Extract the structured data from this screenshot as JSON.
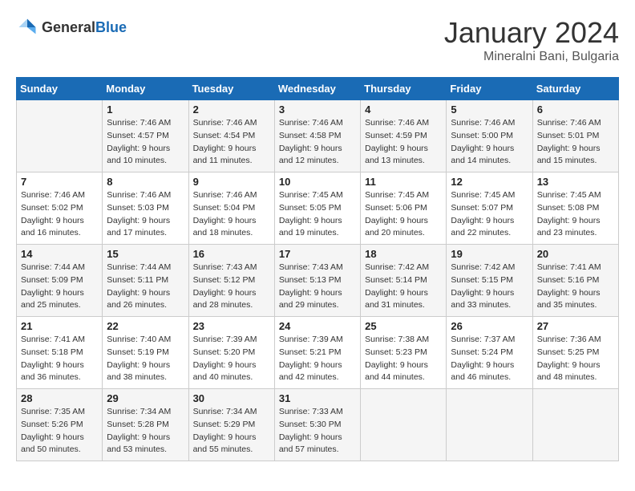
{
  "logo": {
    "text_general": "General",
    "text_blue": "Blue"
  },
  "calendar": {
    "title": "January 2024",
    "subtitle": "Mineralni Bani, Bulgaria"
  },
  "days_of_week": [
    "Sunday",
    "Monday",
    "Tuesday",
    "Wednesday",
    "Thursday",
    "Friday",
    "Saturday"
  ],
  "weeks": [
    [
      {
        "day": "",
        "sunrise": "",
        "sunset": "",
        "daylight": ""
      },
      {
        "day": "1",
        "sunrise": "Sunrise: 7:46 AM",
        "sunset": "Sunset: 4:57 PM",
        "daylight": "Daylight: 9 hours and 10 minutes."
      },
      {
        "day": "2",
        "sunrise": "Sunrise: 7:46 AM",
        "sunset": "Sunset: 4:54 PM",
        "daylight": "Daylight: 9 hours and 11 minutes."
      },
      {
        "day": "3",
        "sunrise": "Sunrise: 7:46 AM",
        "sunset": "Sunset: 4:58 PM",
        "daylight": "Daylight: 9 hours and 12 minutes."
      },
      {
        "day": "4",
        "sunrise": "Sunrise: 7:46 AM",
        "sunset": "Sunset: 4:59 PM",
        "daylight": "Daylight: 9 hours and 13 minutes."
      },
      {
        "day": "5",
        "sunrise": "Sunrise: 7:46 AM",
        "sunset": "Sunset: 5:00 PM",
        "daylight": "Daylight: 9 hours and 14 minutes."
      },
      {
        "day": "6",
        "sunrise": "Sunrise: 7:46 AM",
        "sunset": "Sunset: 5:01 PM",
        "daylight": "Daylight: 9 hours and 15 minutes."
      }
    ],
    [
      {
        "day": "7",
        "sunrise": "Sunrise: 7:46 AM",
        "sunset": "Sunset: 5:02 PM",
        "daylight": "Daylight: 9 hours and 16 minutes."
      },
      {
        "day": "8",
        "sunrise": "Sunrise: 7:46 AM",
        "sunset": "Sunset: 5:03 PM",
        "daylight": "Daylight: 9 hours and 17 minutes."
      },
      {
        "day": "9",
        "sunrise": "Sunrise: 7:46 AM",
        "sunset": "Sunset: 5:04 PM",
        "daylight": "Daylight: 9 hours and 18 minutes."
      },
      {
        "day": "10",
        "sunrise": "Sunrise: 7:45 AM",
        "sunset": "Sunset: 5:05 PM",
        "daylight": "Daylight: 9 hours and 19 minutes."
      },
      {
        "day": "11",
        "sunrise": "Sunrise: 7:45 AM",
        "sunset": "Sunset: 5:06 PM",
        "daylight": "Daylight: 9 hours and 20 minutes."
      },
      {
        "day": "12",
        "sunrise": "Sunrise: 7:45 AM",
        "sunset": "Sunset: 5:07 PM",
        "daylight": "Daylight: 9 hours and 22 minutes."
      },
      {
        "day": "13",
        "sunrise": "Sunrise: 7:45 AM",
        "sunset": "Sunset: 5:08 PM",
        "daylight": "Daylight: 9 hours and 23 minutes."
      }
    ],
    [
      {
        "day": "14",
        "sunrise": "Sunrise: 7:44 AM",
        "sunset": "Sunset: 5:09 PM",
        "daylight": "Daylight: 9 hours and 25 minutes."
      },
      {
        "day": "15",
        "sunrise": "Sunrise: 7:44 AM",
        "sunset": "Sunset: 5:11 PM",
        "daylight": "Daylight: 9 hours and 26 minutes."
      },
      {
        "day": "16",
        "sunrise": "Sunrise: 7:43 AM",
        "sunset": "Sunset: 5:12 PM",
        "daylight": "Daylight: 9 hours and 28 minutes."
      },
      {
        "day": "17",
        "sunrise": "Sunrise: 7:43 AM",
        "sunset": "Sunset: 5:13 PM",
        "daylight": "Daylight: 9 hours and 29 minutes."
      },
      {
        "day": "18",
        "sunrise": "Sunrise: 7:42 AM",
        "sunset": "Sunset: 5:14 PM",
        "daylight": "Daylight: 9 hours and 31 minutes."
      },
      {
        "day": "19",
        "sunrise": "Sunrise: 7:42 AM",
        "sunset": "Sunset: 5:15 PM",
        "daylight": "Daylight: 9 hours and 33 minutes."
      },
      {
        "day": "20",
        "sunrise": "Sunrise: 7:41 AM",
        "sunset": "Sunset: 5:16 PM",
        "daylight": "Daylight: 9 hours and 35 minutes."
      }
    ],
    [
      {
        "day": "21",
        "sunrise": "Sunrise: 7:41 AM",
        "sunset": "Sunset: 5:18 PM",
        "daylight": "Daylight: 9 hours and 36 minutes."
      },
      {
        "day": "22",
        "sunrise": "Sunrise: 7:40 AM",
        "sunset": "Sunset: 5:19 PM",
        "daylight": "Daylight: 9 hours and 38 minutes."
      },
      {
        "day": "23",
        "sunrise": "Sunrise: 7:39 AM",
        "sunset": "Sunset: 5:20 PM",
        "daylight": "Daylight: 9 hours and 40 minutes."
      },
      {
        "day": "24",
        "sunrise": "Sunrise: 7:39 AM",
        "sunset": "Sunset: 5:21 PM",
        "daylight": "Daylight: 9 hours and 42 minutes."
      },
      {
        "day": "25",
        "sunrise": "Sunrise: 7:38 AM",
        "sunset": "Sunset: 5:23 PM",
        "daylight": "Daylight: 9 hours and 44 minutes."
      },
      {
        "day": "26",
        "sunrise": "Sunrise: 7:37 AM",
        "sunset": "Sunset: 5:24 PM",
        "daylight": "Daylight: 9 hours and 46 minutes."
      },
      {
        "day": "27",
        "sunrise": "Sunrise: 7:36 AM",
        "sunset": "Sunset: 5:25 PM",
        "daylight": "Daylight: 9 hours and 48 minutes."
      }
    ],
    [
      {
        "day": "28",
        "sunrise": "Sunrise: 7:35 AM",
        "sunset": "Sunset: 5:26 PM",
        "daylight": "Daylight: 9 hours and 50 minutes."
      },
      {
        "day": "29",
        "sunrise": "Sunrise: 7:34 AM",
        "sunset": "Sunset: 5:28 PM",
        "daylight": "Daylight: 9 hours and 53 minutes."
      },
      {
        "day": "30",
        "sunrise": "Sunrise: 7:34 AM",
        "sunset": "Sunset: 5:29 PM",
        "daylight": "Daylight: 9 hours and 55 minutes."
      },
      {
        "day": "31",
        "sunrise": "Sunrise: 7:33 AM",
        "sunset": "Sunset: 5:30 PM",
        "daylight": "Daylight: 9 hours and 57 minutes."
      },
      {
        "day": "",
        "sunrise": "",
        "sunset": "",
        "daylight": ""
      },
      {
        "day": "",
        "sunrise": "",
        "sunset": "",
        "daylight": ""
      },
      {
        "day": "",
        "sunrise": "",
        "sunset": "",
        "daylight": ""
      }
    ]
  ]
}
